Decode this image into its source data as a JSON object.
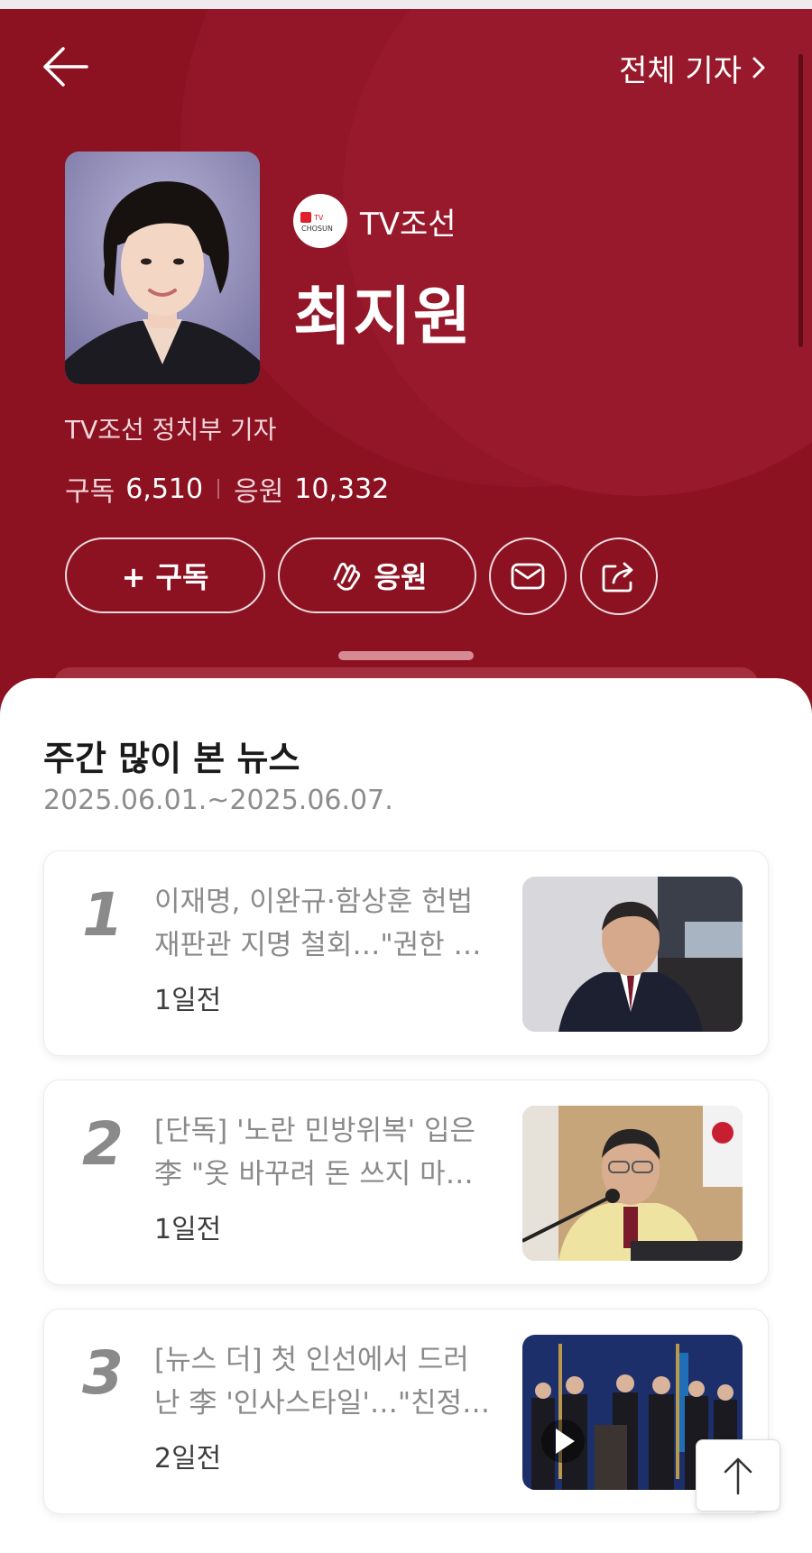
{
  "header": {
    "back_icon": "arrow-left-icon",
    "all_reporters_label": "전체 기자",
    "all_reporters_icon": "chevron-right-icon"
  },
  "profile": {
    "press_logo_text_top": "TV",
    "press_logo_text_bottom": "CHOSUN",
    "press_name": "TV조선",
    "name": "최지원",
    "department": "TV조선 정치부 기자",
    "subscribe_label": "구독",
    "subscribe_count": "6,510",
    "cheer_label": "응원",
    "cheer_count": "10,332"
  },
  "actions": {
    "subscribe_button": "+ 구독",
    "cheer_button": "응원",
    "cheer_icon": "clap-hand-icon",
    "mail_icon": "mail-icon",
    "share_icon": "share-icon"
  },
  "weekly": {
    "title": "주간 많이 본 뉴스",
    "date_range": "2025.06.01.~2025.06.07.",
    "items": [
      {
        "rank": "1",
        "line1": "이재명, 이완규·함상훈 헌법",
        "line2": "재판관 지명 철회…\"권한 …",
        "time": "1일전"
      },
      {
        "rank": "2",
        "line1": "[단독] '노란 민방위복' 입은",
        "line2": "李 \"옷 바꾸려 돈 쓰지 마…",
        "time": "1일전"
      },
      {
        "rank": "3",
        "line1": "[뉴스 더] 첫 인선에서 드러",
        "line2": "난 李 '인사스타일'…\"친정…",
        "time": "2일전"
      }
    ]
  },
  "scroll_top_icon": "arrow-up-icon",
  "colors": {
    "hero_bg": "#8c1222",
    "accent": "#b5172f"
  }
}
